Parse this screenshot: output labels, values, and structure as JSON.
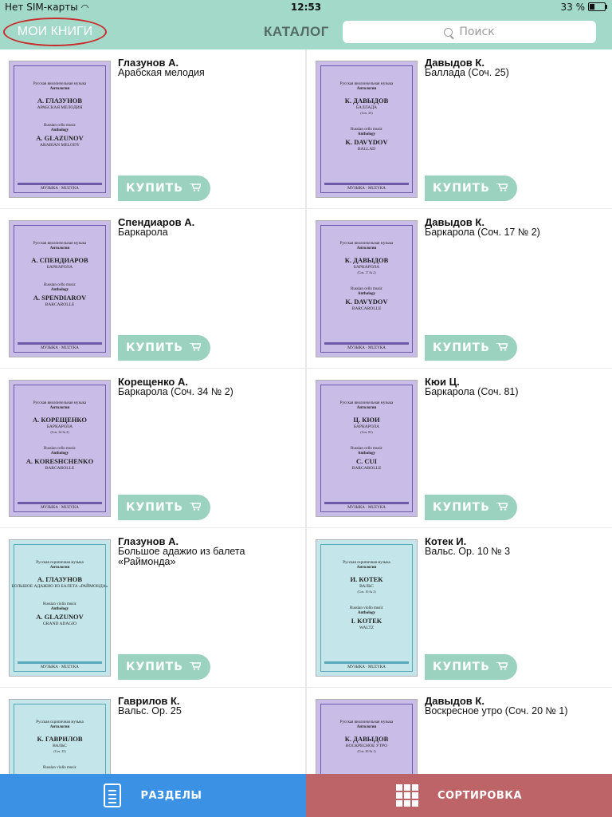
{
  "status_bar": {
    "carrier": "Нет SIM-карты",
    "time": "12:53",
    "battery": "33 %",
    "battery_level": 0.33
  },
  "nav": {
    "my_books": "МОИ КНИГИ",
    "title": "КАТАЛОГ",
    "search_placeholder": "Поиск"
  },
  "buy_label": "КУПИТЬ",
  "items": [
    {
      "author": "Глазунов А.",
      "title": "Арабская мелодия",
      "cover": {
        "style": "lav",
        "series": "Русская виолончельная музыка",
        "anthology": "Антология",
        "author": "А. ГЛАЗУНОВ",
        "work": "АРАБСКАЯ МЕЛОДИЯ",
        "opus": "",
        "series_en": "Russian cello music",
        "anthology_en": "Anthology",
        "author_en": "A. GLAZUNOV",
        "work_en": "ARABIAN MELODY",
        "publisher": "МУЗЫКА · MUZYKA"
      }
    },
    {
      "author": "Давыдов К.",
      "title": "Баллада (Соч. 25)",
      "cover": {
        "style": "lav",
        "series": "Русская виолончельная музыка",
        "anthology": "Антология",
        "author": "К. ДАВЫДОВ",
        "work": "БАЛЛАДА",
        "opus": "(Соч. 25)",
        "series_en": "Russian cello music",
        "anthology_en": "Anthology",
        "author_en": "K. DAVYDOV",
        "work_en": "BALLAD",
        "publisher": "МУЗЫКА · MUZYKA"
      }
    },
    {
      "author": "Спендиаров А.",
      "title": "Баркарола",
      "cover": {
        "style": "lav",
        "series": "Русская виолончельная музыка",
        "anthology": "Антология",
        "author": "А. СПЕНДИАРОВ",
        "work": "БАРКАРОЛА",
        "opus": "",
        "series_en": "Russian cello music",
        "anthology_en": "Anthology",
        "author_en": "A. SPENDIAROV",
        "work_en": "BARCAROLLE",
        "publisher": "МУЗЫКА · MUZYKA"
      }
    },
    {
      "author": "Давыдов К.",
      "title": "Баркарола (Соч. 17 № 2)",
      "cover": {
        "style": "lav",
        "series": "Русская виолончельная музыка",
        "anthology": "Антология",
        "author": "К. ДАВЫДОВ",
        "work": "БАРКАРОЛА",
        "opus": "(Соч. 17 № 2)",
        "series_en": "Russian cello music",
        "anthology_en": "Anthology",
        "author_en": "K. DAVYDOV",
        "work_en": "BARCAROLLE",
        "publisher": "МУЗЫКА · MUZYKA"
      }
    },
    {
      "author": "Корещенко А.",
      "title": "Баркарола (Соч. 34 № 2)",
      "cover": {
        "style": "lav",
        "series": "Русская виолончельная музыка",
        "anthology": "Антология",
        "author": "А. КОРЕЩЕНКО",
        "work": "БАРКАРОЛА",
        "opus": "(Соч. 34 № 2)",
        "series_en": "Russian cello music",
        "anthology_en": "Anthology",
        "author_en": "A. KORESHCHENKO",
        "work_en": "BARCAROLLE",
        "publisher": "МУЗЫКА · MUZYKA"
      }
    },
    {
      "author": "Кюи Ц.",
      "title": "Баркарола (Соч. 81)",
      "cover": {
        "style": "lav",
        "series": "Русская виолончельная музыка",
        "anthology": "Антология",
        "author": "Ц. КЮИ",
        "work": "БАРКАРОЛА",
        "opus": "(Соч. 81)",
        "series_en": "Russian cello music",
        "anthology_en": "Anthology",
        "author_en": "C. CUI",
        "work_en": "BARCAROLLE",
        "publisher": "МУЗЫКА · MUZYKA"
      }
    },
    {
      "author": "Глазунов А.",
      "title": "Большое адажио из балета «Раймонда»",
      "cover": {
        "style": "aqua",
        "series": "Русская скрипичная музыка",
        "anthology": "Антология",
        "author": "А. ГЛАЗУНОВ",
        "work": "БОЛЬШОЕ АДАЖИО ИЗ БАЛЕТА «РАЙМОНДА»",
        "opus": "",
        "series_en": "Russian violin music",
        "anthology_en": "Anthology",
        "author_en": "A. GLAZUNOV",
        "work_en": "GRAND ADAGIO",
        "publisher": "МУЗЫКА · MUZYKA"
      }
    },
    {
      "author": "Котек И.",
      "title": "Вальс. Ор. 10 № 3",
      "cover": {
        "style": "aqua",
        "series": "Русская скрипичная музыка",
        "anthology": "Антология",
        "author": "И. КОТЕК",
        "work": "ВАЛЬС",
        "opus": "(Соч. 10 № 3)",
        "series_en": "Russian violin music",
        "anthology_en": "Anthology",
        "author_en": "I. KOTEK",
        "work_en": "WALTZ",
        "publisher": "МУЗЫКА · MUZYKA"
      }
    },
    {
      "author": "Гаврилов К.",
      "title": "Вальс. Ор. 25",
      "cover": {
        "style": "aqua",
        "series": "Русская скрипичная музыка",
        "anthology": "Антология",
        "author": "К. ГАВРИЛОВ",
        "work": "ВАЛЬС",
        "opus": "(Соч. 25)",
        "series_en": "Russian violin music",
        "anthology_en": "",
        "author_en": "",
        "work_en": "",
        "publisher": ""
      }
    },
    {
      "author": "Давыдов К.",
      "title": "Воскресное утро (Соч. 20 № 1)",
      "cover": {
        "style": "lav",
        "series": "Русская виолончельная музыка",
        "anthology": "Антология",
        "author": "К. ДАВЫДОВ",
        "work": "ВОСКРЕСНОЕ УТРО",
        "opus": "(Соч. 20 № 1)",
        "series_en": "",
        "anthology_en": "",
        "author_en": "",
        "work_en": "",
        "publisher": ""
      }
    }
  ],
  "tabs": {
    "sections": "РАЗДЕЛЫ",
    "sort": "СОРТИРОВКА"
  },
  "colors": {
    "header": "#a3d9c9",
    "buy_button": "#9bd2bf",
    "tab_sections": "#3b92e5",
    "tab_sort": "#bd6469",
    "highlight_circle": "#c92a2a"
  }
}
